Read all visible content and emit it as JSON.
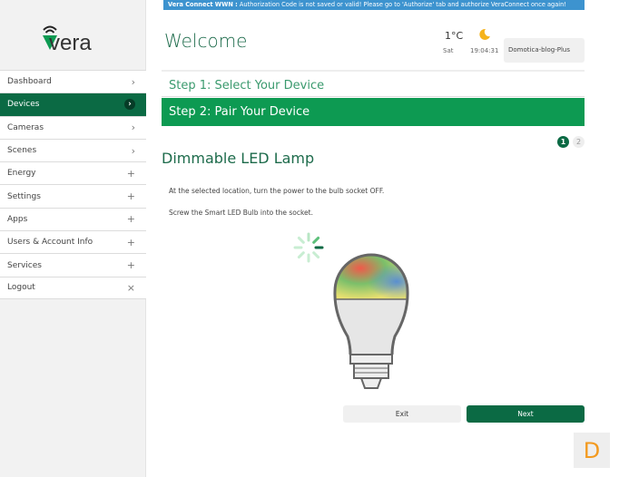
{
  "brand": "vera",
  "sidebar": {
    "items": [
      {
        "label": "Dashboard",
        "icon": "›"
      },
      {
        "label": "Devices",
        "icon": "›",
        "active": true
      },
      {
        "label": "Cameras",
        "icon": "›"
      },
      {
        "label": "Scenes",
        "icon": "›"
      },
      {
        "label": "Energy",
        "icon": "+"
      },
      {
        "label": "Settings",
        "icon": "+"
      },
      {
        "label": "Apps",
        "icon": "+"
      },
      {
        "label": "Users & Account Info",
        "icon": "+"
      },
      {
        "label": "Services",
        "icon": "+"
      },
      {
        "label": "Logout",
        "icon": "×"
      }
    ]
  },
  "banner": {
    "bold": "Vera Connect WWN :",
    "text": " Authorization Code is not saved or valid! Please go to 'Authorize' tab and authorize VeraConnect once again!"
  },
  "header": {
    "title": "Welcome",
    "temperature": "1°C",
    "day": "Sat",
    "time": "19:04:31",
    "device": "Domotica-blog-Plus"
  },
  "wizard": {
    "step1": "Step 1: Select Your Device",
    "step2": "Step 2: Pair Your Device",
    "page_current": "1",
    "page_next": "2",
    "device_title": "Dimmable LED Lamp",
    "instructions": [
      "At the selected location, turn the power to the bulb socket OFF.",
      "Screw the Smart LED Bulb into the socket."
    ],
    "exit_label": "Exit",
    "next_label": "Next"
  },
  "badge": "D",
  "colors": {
    "brand_green": "#0b6a44",
    "step_green": "#0d9a52",
    "banner_blue": "#3d93cf"
  }
}
